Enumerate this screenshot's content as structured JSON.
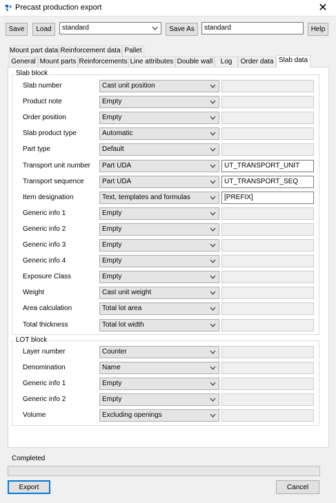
{
  "window": {
    "title": "Precast production export",
    "close": "✕"
  },
  "toolbar": {
    "save": "Save",
    "load": "Load",
    "preset": "standard",
    "save_as": "Save As",
    "save_as_name": "standard",
    "help": "Help"
  },
  "tabs_row1": [
    "Mount part data",
    "Reinforcement data",
    "Pallet"
  ],
  "tabs_row2": [
    "General",
    "Mount parts",
    "Reinforcements",
    "Line attributes",
    "Double wall",
    "Log",
    "Order data",
    "Slab data"
  ],
  "active_tab": "Slab data",
  "slab_block": {
    "title": "Slab block",
    "rows": [
      {
        "label": "Slab number",
        "value": "Cast unit position",
        "extra": ""
      },
      {
        "label": "Product note",
        "value": "Empty",
        "extra": ""
      },
      {
        "label": "Order position",
        "value": "Empty",
        "extra": ""
      },
      {
        "label": "Slab product type",
        "value": "Automatic",
        "extra": ""
      },
      {
        "label": "Part type",
        "value": "Default",
        "extra": ""
      },
      {
        "label": "Transport unit number",
        "value": "Part UDA",
        "extra": "UT_TRANSPORT_UNIT"
      },
      {
        "label": "Transport sequence",
        "value": "Part UDA",
        "extra": "UT_TRANSPORT_SEQ"
      },
      {
        "label": "Item designation",
        "value": "Text, templates and formulas",
        "extra": "[PREFIX]"
      },
      {
        "label": "Generic info 1",
        "value": "Empty",
        "extra": ""
      },
      {
        "label": "Generic info 2",
        "value": "Empty",
        "extra": ""
      },
      {
        "label": "Generic info 3",
        "value": "Empty",
        "extra": ""
      },
      {
        "label": "Generic info 4",
        "value": "Empty",
        "extra": ""
      },
      {
        "label": "Exposure Class",
        "value": "Empty",
        "extra": ""
      },
      {
        "label": "Weight",
        "value": "Cast unit weight",
        "extra": ""
      },
      {
        "label": "Area calculation",
        "value": "Total lot area",
        "extra": ""
      },
      {
        "label": "Total thickness",
        "value": "Total lot width",
        "extra": ""
      }
    ]
  },
  "lot_block": {
    "title": "LOT block",
    "rows": [
      {
        "label": "Layer number",
        "value": "Counter",
        "extra": ""
      },
      {
        "label": "Denomination",
        "value": "Name",
        "extra": ""
      },
      {
        "label": "Generic info 1",
        "value": "Empty",
        "extra": ""
      },
      {
        "label": "Generic info 2",
        "value": "Empty",
        "extra": ""
      },
      {
        "label": "Volume",
        "value": "Excluding openings",
        "extra": ""
      }
    ]
  },
  "status": "Completed",
  "progress": 0,
  "footer": {
    "export": "Export",
    "cancel": "Cancel"
  }
}
